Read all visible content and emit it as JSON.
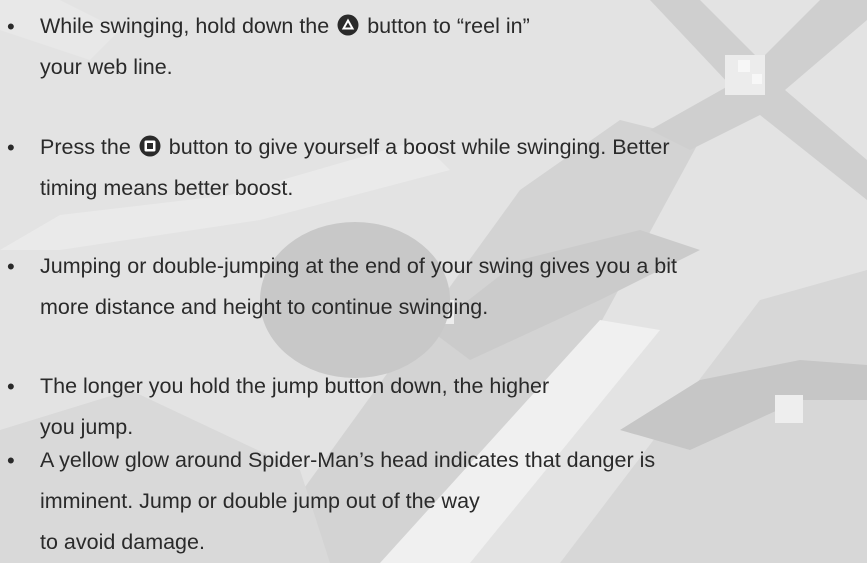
{
  "background": {
    "colors": {
      "base": "#e2e2e2",
      "shape_light": "#efefef",
      "shape_mid": "#d0d0d0",
      "shape_dark": "#bdbdbd"
    }
  },
  "icons": {
    "triangle": "triangle-button-icon",
    "square": "square-button-icon"
  },
  "bullets": [
    {
      "lines": [
        "While swinging, hold down the",
        "button to “reel in”",
        "your web line."
      ]
    },
    {
      "lines": [
        "Press the",
        "button to give yourself a boost while swinging. Better",
        "timing means better boost."
      ]
    },
    {
      "lines": [
        "Jumping or double-jumping at the end of your swing gives you a bit",
        "more distance and height to continue swinging."
      ]
    },
    {
      "lines": [
        "The longer you hold the jump button down, the higher",
        "you jump."
      ]
    },
    {
      "lines": [
        "A yellow glow around Spider-Man’s head indicates that danger is",
        "imminent. Jump or double jump out of the way",
        "to avoid damage."
      ]
    }
  ]
}
